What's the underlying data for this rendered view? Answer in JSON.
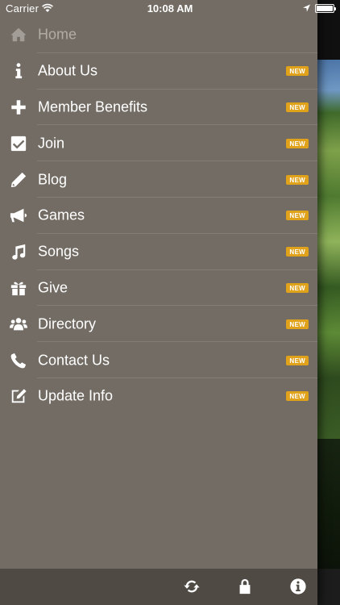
{
  "status_bar": {
    "carrier": "Carrier",
    "time": "10:08 AM"
  },
  "menu": {
    "badge_color": "#e0a21b",
    "drawer_color": "#726c64",
    "items": [
      {
        "label": "Home",
        "icon": "home-icon",
        "badge": ""
      },
      {
        "label": "About Us",
        "icon": "info-icon",
        "badge": "NEW"
      },
      {
        "label": "Member Benefits",
        "icon": "plus-icon",
        "badge": "NEW"
      },
      {
        "label": "Join",
        "icon": "checkbox-icon",
        "badge": "NEW"
      },
      {
        "label": "Blog",
        "icon": "pencil-icon",
        "badge": "NEW"
      },
      {
        "label": "Games",
        "icon": "megaphone-icon",
        "badge": "NEW"
      },
      {
        "label": "Songs",
        "icon": "music-note-icon",
        "badge": "NEW"
      },
      {
        "label": "Give",
        "icon": "gift-icon",
        "badge": "NEW"
      },
      {
        "label": "Directory",
        "icon": "users-icon",
        "badge": "NEW"
      },
      {
        "label": "Contact Us",
        "icon": "phone-icon",
        "badge": "NEW"
      },
      {
        "label": "Update Info",
        "icon": "edit-icon",
        "badge": "NEW"
      }
    ]
  },
  "toolbar": {
    "buttons": [
      "refresh-icon",
      "lock-icon",
      "info-circle-icon"
    ]
  }
}
